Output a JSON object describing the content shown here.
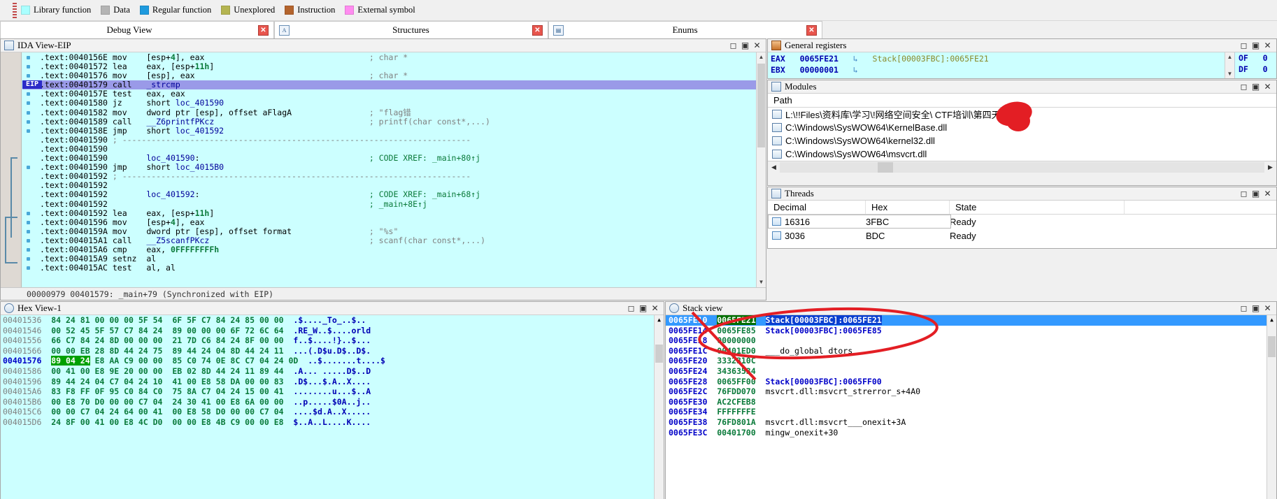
{
  "legend": {
    "items": [
      {
        "label": "Library function",
        "color": "#aaffff"
      },
      {
        "label": "Data",
        "color": "#b4b4b4"
      },
      {
        "label": "Regular function",
        "color": "#1e9ade"
      },
      {
        "label": "Unexplored",
        "color": "#b4b450"
      },
      {
        "label": "Instruction",
        "color": "#b4642d"
      },
      {
        "label": "External symbol",
        "color": "#ff8cf0"
      }
    ]
  },
  "tabs": [
    {
      "label": "Debug View",
      "icon": "close-icon",
      "active": true
    },
    {
      "label": "Structures",
      "icon": "structures-icon",
      "active": false
    },
    {
      "label": "Enums",
      "icon": "enums-icon",
      "active": false
    }
  ],
  "ida_view": {
    "title": "IDA View-EIP",
    "icon": "ida-view-icon",
    "eip_marker": "EIP",
    "status": "00000979 00401579: _main+79 (Synchronized with EIP)",
    "window_buttons": [
      "minimize",
      "restore",
      "close"
    ],
    "lines": [
      {
        "addr": ".text:0040156E",
        "mn": "mov",
        "ops": "[esp+4], eax",
        "cmt": "; char *",
        "bullet": true
      },
      {
        "addr": ".text:00401572",
        "mn": "lea",
        "ops": "eax, [esp+11h]",
        "cmt": "",
        "bullet": true
      },
      {
        "addr": ".text:00401576",
        "mn": "mov",
        "ops": "[esp], eax",
        "cmt": "; char *",
        "bullet": true
      },
      {
        "addr": ".text:00401579",
        "mn": "call",
        "ops": "_strcmp",
        "cmt": "",
        "bullet": true,
        "eip": true,
        "highlight": true
      },
      {
        "addr": ".text:0040157E",
        "mn": "test",
        "ops": "eax, eax",
        "cmt": "",
        "bullet": true
      },
      {
        "addr": ".text:00401580",
        "mn": "jz",
        "ops": "short loc_401590",
        "cmt": "",
        "bullet": true
      },
      {
        "addr": ".text:00401582",
        "mn": "mov",
        "ops": "dword ptr [esp], offset aFlagA",
        "cmt": "; \"flag错",
        "bullet": true
      },
      {
        "addr": ".text:00401589",
        "mn": "call",
        "ops": "__Z6printfPKcz",
        "cmt": "; printf(char const*,...)",
        "bullet": true
      },
      {
        "addr": ".text:0040158E",
        "mn": "jmp",
        "ops": "short loc_401592",
        "cmt": "",
        "bullet": true
      },
      {
        "addr": ".text:00401590",
        "mn": "",
        "ops": "",
        "cmt": "",
        "separator": true
      },
      {
        "addr": ".text:00401590",
        "mn": "",
        "ops": "",
        "cmt": ""
      },
      {
        "addr": ".text:00401590",
        "mn": "",
        "ops": "loc_401590:",
        "cmt": "; CODE XREF: _main+80↑j",
        "label": true
      },
      {
        "addr": ".text:00401590",
        "mn": "jmp",
        "ops": "short loc_4015B0",
        "cmt": "",
        "bullet": true,
        "inarrow": true
      },
      {
        "addr": ".text:00401592",
        "mn": "",
        "ops": "",
        "cmt": "",
        "separator": true
      },
      {
        "addr": ".text:00401592",
        "mn": "",
        "ops": "",
        "cmt": ""
      },
      {
        "addr": ".text:00401592",
        "mn": "",
        "ops": "loc_401592:",
        "cmt": "; CODE XREF: _main+68↑j",
        "label": true
      },
      {
        "addr": ".text:00401592",
        "mn": "",
        "ops": "",
        "cmt": "; _main+8E↑j"
      },
      {
        "addr": ".text:00401592",
        "mn": "lea",
        "ops": "eax, [esp+11h]",
        "cmt": "",
        "bullet": true,
        "inarrow": true
      },
      {
        "addr": ".text:00401596",
        "mn": "mov",
        "ops": "[esp+4], eax",
        "cmt": "",
        "bullet": true
      },
      {
        "addr": ".text:0040159A",
        "mn": "mov",
        "ops": "dword ptr [esp], offset format",
        "cmt": "; \"%s\"",
        "bullet": true
      },
      {
        "addr": ".text:004015A1",
        "mn": "call",
        "ops": "__Z5scanfPKcz",
        "cmt": "; scanf(char const*,...)",
        "bullet": true
      },
      {
        "addr": ".text:004015A6",
        "mn": "cmp",
        "ops": "eax, 0FFFFFFFFh",
        "cmt": "",
        "bullet": true
      },
      {
        "addr": ".text:004015A9",
        "mn": "setnz",
        "ops": "al",
        "cmt": "",
        "bullet": true
      },
      {
        "addr": ".text:004015AC",
        "mn": "test",
        "ops": "al, al",
        "cmt": "",
        "bullet": true
      }
    ]
  },
  "registers": {
    "title": "General registers",
    "icon": "bug-icon",
    "rows": [
      {
        "name": "EAX",
        "value": "0065FE21",
        "arrow": "↳",
        "target": "Stack[00003FBC]:0065FE21"
      },
      {
        "name": "EBX",
        "value": "00000001",
        "arrow": "↳",
        "target": ""
      }
    ],
    "flags": [
      {
        "name": "OF",
        "value": "0"
      },
      {
        "name": "DF",
        "value": "0"
      }
    ],
    "window_buttons": [
      "minimize",
      "restore",
      "close"
    ]
  },
  "modules": {
    "title": "Modules",
    "icon": "modules-icon",
    "column": "Path",
    "rows": [
      {
        "path": "L:\\!!Files\\资料库\\学习\\!网络空间安全\\  CTF培训\\第四天\\0.exe",
        "redacted": true
      },
      {
        "path": "C:\\Windows\\SysWOW64\\KernelBase.dll",
        "redacted": false
      },
      {
        "path": "C:\\Windows\\SysWOW64\\kernel32.dll",
        "redacted": false
      },
      {
        "path": "C:\\Windows\\SysWOW64\\msvcrt.dll",
        "redacted": false
      }
    ],
    "window_buttons": [
      "minimize",
      "restore",
      "close"
    ]
  },
  "threads": {
    "title": "Threads",
    "icon": "threads-icon",
    "columns": [
      "Decimal",
      "Hex",
      "State"
    ],
    "rows": [
      {
        "decimal": "16316",
        "hex": "3FBC",
        "state": "Ready",
        "selected": true
      },
      {
        "decimal": "3036",
        "hex": "BDC",
        "state": "Ready",
        "selected": false
      }
    ],
    "window_buttons": [
      "minimize",
      "restore",
      "close"
    ]
  },
  "hex_view": {
    "title": "Hex View-1",
    "icon": "hex-view-icon",
    "window_buttons": [
      "minimize",
      "restore",
      "close"
    ],
    "rows": [
      {
        "addr": "00401536",
        "b1": "84 24 81 00 00 00 5F 54",
        "b2": "6F 5F C7 84 24 85 00 00",
        "ascii": ".$...._To_..$..",
        "selected": false
      },
      {
        "addr": "00401546",
        "b1": "00 52 45 5F 57 C7 84 24",
        "b2": "89 00 00 00 6F 72 6C 64",
        "ascii": ".RE_W..$....orld",
        "selected": false
      },
      {
        "addr": "00401556",
        "b1": "66 C7 84 24 8D 00 00 00",
        "b2": "21 7D C6 84 24 8F 00 00",
        "ascii": "f..$....!}..$...",
        "selected": false
      },
      {
        "addr": "00401566",
        "b1": "00 00 EB 28 8D 44 24 75",
        "b2": "89 44 24 04 8D 44 24 11",
        "ascii": "...(.D$u.D$..D$.",
        "selected": false
      },
      {
        "addr": "00401576",
        "b1": "89 04 24 E8 AA C9 00 00",
        "b2": "85 C0 74 0E 8C C7 04 24 0D",
        "ascii": "..$.......t....$",
        "selected": true
      },
      {
        "addr": "00401586",
        "b1": "00 41 00 E8 9E 20 00 00",
        "b2": "EB 02 8D 44 24 11 89 44",
        "ascii": ".A... .....D$..D",
        "selected": false
      },
      {
        "addr": "00401596",
        "b1": "89 44 24 04 C7 04 24 10",
        "b2": "41 00 E8 58 DA 00 00 83",
        "ascii": ".D$...$.A..X....",
        "selected": false
      },
      {
        "addr": "004015A6",
        "b1": "83 F8 FF 0F 95 C0 84 C0",
        "b2": "75 8A C7 04 24 15 00 41",
        "ascii": "........u...$..A",
        "selected": false
      },
      {
        "addr": "004015B6",
        "b1": "00 E8 70 D0 00 00 C7 04",
        "b2": "24 30 41 00 E8 6A 00 00",
        "ascii": "..p.....$0A..j..",
        "selected": false
      },
      {
        "addr": "004015C6",
        "b1": "00 00 C7 04 24 64 00 41",
        "b2": "00 E8 58 D0 00 00 C7 04",
        "ascii": "....$d.A..X.....",
        "selected": false
      },
      {
        "addr": "004015D6",
        "b1": "24 8F 00 41 00 E8 4C D0",
        "b2": "00 00 E8 4B C9 00 00 E8",
        "ascii": "$..A..L....K....",
        "selected": false
      }
    ]
  },
  "stack_view": {
    "title": "Stack view",
    "icon": "stack-view-icon",
    "window_buttons": [
      "minimize",
      "restore",
      "close"
    ],
    "rows": [
      {
        "addr": "0065FE10",
        "value": "0065FE21",
        "note": "Stack[00003FBC]:0065FE21",
        "selected": true,
        "value_highlight": true
      },
      {
        "addr": "0065FE14",
        "value": "0065FE85",
        "note": "Stack[00003FBC]:0065FE85",
        "selected": false,
        "value_highlight": false
      },
      {
        "addr": "0065FE18",
        "value": "00000000",
        "note": "",
        "selected": false,
        "value_highlight": false
      },
      {
        "addr": "0065FE1C",
        "value": "00401ED0",
        "note": "___do_global_dtors",
        "selected": false,
        "value_highlight": false
      },
      {
        "addr": "0065FE20",
        "value": "3332310C",
        "note": "",
        "selected": false,
        "value_highlight": false
      },
      {
        "addr": "0065FE24",
        "value": "34363534",
        "note": "",
        "selected": false,
        "value_highlight": false
      },
      {
        "addr": "0065FE28",
        "value": "0065FF00",
        "note": "Stack[00003FBC]:0065FF00",
        "selected": false,
        "value_highlight": false
      },
      {
        "addr": "0065FE2C",
        "value": "76FDD070",
        "note": "msvcrt.dll:msvcrt_strerror_s+4A0",
        "selected": false,
        "value_highlight": false
      },
      {
        "addr": "0065FE30",
        "value": "AC2CFEB8",
        "note": "",
        "selected": false,
        "value_highlight": false
      },
      {
        "addr": "0065FE34",
        "value": "FFFFFFFE",
        "note": "",
        "selected": false,
        "value_highlight": false
      },
      {
        "addr": "0065FE38",
        "value": "76FD801A",
        "note": "msvcrt.dll:msvcrt___onexit+3A",
        "selected": false,
        "value_highlight": false
      },
      {
        "addr": "0065FE3C",
        "value": "00401700",
        "note": "mingw_onexit+30",
        "selected": false,
        "value_highlight": false
      }
    ]
  },
  "annotations": {
    "ink_color": "#e31e24",
    "ellipse_label": "stack-row-circled",
    "blob_label": "path-redaction-blob"
  }
}
